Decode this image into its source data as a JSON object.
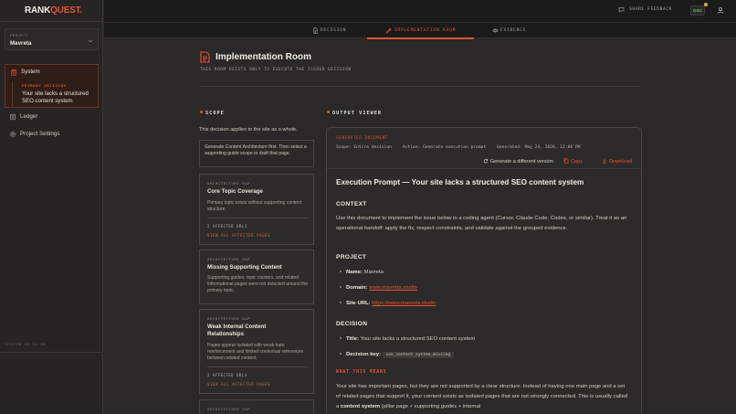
{
  "app": {
    "logo_prefix": "RANK",
    "logo_suffix": "QUEST."
  },
  "sidebar": {
    "project_label": "PROJECT",
    "project_name": "Mavreta",
    "system_label": "System",
    "primary_tag": "PRIMARY DECISION",
    "primary_text": "Your site lacks a structured SEO content system",
    "ledger_label": "Ledger",
    "settings_label": "Project Settings",
    "version": "SYSTEM V0.14.36"
  },
  "topbar": {
    "share_label": "SHARE FEEDBACK",
    "gsc_label": "GSC"
  },
  "tabs": {
    "decision": "DECISION",
    "implementation": "IMPLEMENTATION ROOM",
    "evidence": "EVIDENCE"
  },
  "header": {
    "title": "Implementation Room",
    "subtitle": "THIS ROOM EXISTS ONLY TO EXECUTE THE ISSUED DECISION"
  },
  "scope": {
    "heading": "SCOPE",
    "description": "This decision applies to the site as a whole.",
    "note": "Generate Content Architecture first. Then select a supporting guide scope to draft that page.",
    "gaps": [
      {
        "tag": "ARCHITECTURE GAP",
        "title": "Core Topic Coverage",
        "desc": "Primary topic exists without supporting content structure.",
        "urls": "2 AFFECTED URLS",
        "link": "VIEW ALL AFFECTED PAGES"
      },
      {
        "tag": "ARCHITECTURE GAP",
        "title": "Missing Supporting Content",
        "desc": "Supporting guides, topic clusters, and related informational pages were not detected around the primary topic."
      },
      {
        "tag": "ARCHITECTURE GAP",
        "title": "Weak Internal Content Relationships",
        "desc": "Pages appear isolated with weak topic reinforcement and limited contextual references between related content.",
        "urls": "2 AFFECTED URLS",
        "link": "VIEW ALL AFFECTED PAGES"
      },
      {
        "tag": "ARCHITECTURE GAP"
      }
    ]
  },
  "output": {
    "heading": "OUTPUT VIEWER",
    "tag": "GENERATED DOCUMENT",
    "meta_scope": "Scope: Entire decision",
    "meta_action": "Action: Generate execution prompt",
    "meta_generated": "Generated: May 24, 2026, 12:06 PM",
    "regen_label": "Generate a different version",
    "copy_label": "Copy",
    "download_label": "Download",
    "doc_title": "Execution Prompt — Your site lacks a structured SEO content system",
    "context_h": "CONTEXT",
    "context_p": "Use this document to implement the issue below in a coding agent (Cursor, Claude Code, Codex, or similar). Treat it as an operational handoff: apply the fix, respect constraints, and validate against the grouped evidence.",
    "project_h": "PROJECT",
    "name_key": "Name:",
    "name_val": "Mavreta",
    "domain_key": "Domain:",
    "domain_val": "www.mavreta.studio",
    "url_key": "Site URL:",
    "url_val": "https://www.mavreta.studio",
    "decision_h": "DECISION",
    "dtitle_key": "Title:",
    "dtitle_val": "Your site lacks a structured SEO content system",
    "dkey_key": "Decision key:",
    "dkey_val": "seo_content_system_missing",
    "means_h": "WHAT THIS MEANS",
    "means_p1": "Your site has important pages, but they are not supported by a clear structure. Instead of having one main page and a set of related pages that support it, your content exists as isolated pages that are not strongly connected. This is usually called a ",
    "means_bold": "content system",
    "means_p2": " (pillar page + supporting guides + internal"
  },
  "colors": {
    "accent": "#e8542c",
    "bg": "#2a2828",
    "sidebar": "#262424",
    "topbar": "#1c1b1b"
  }
}
